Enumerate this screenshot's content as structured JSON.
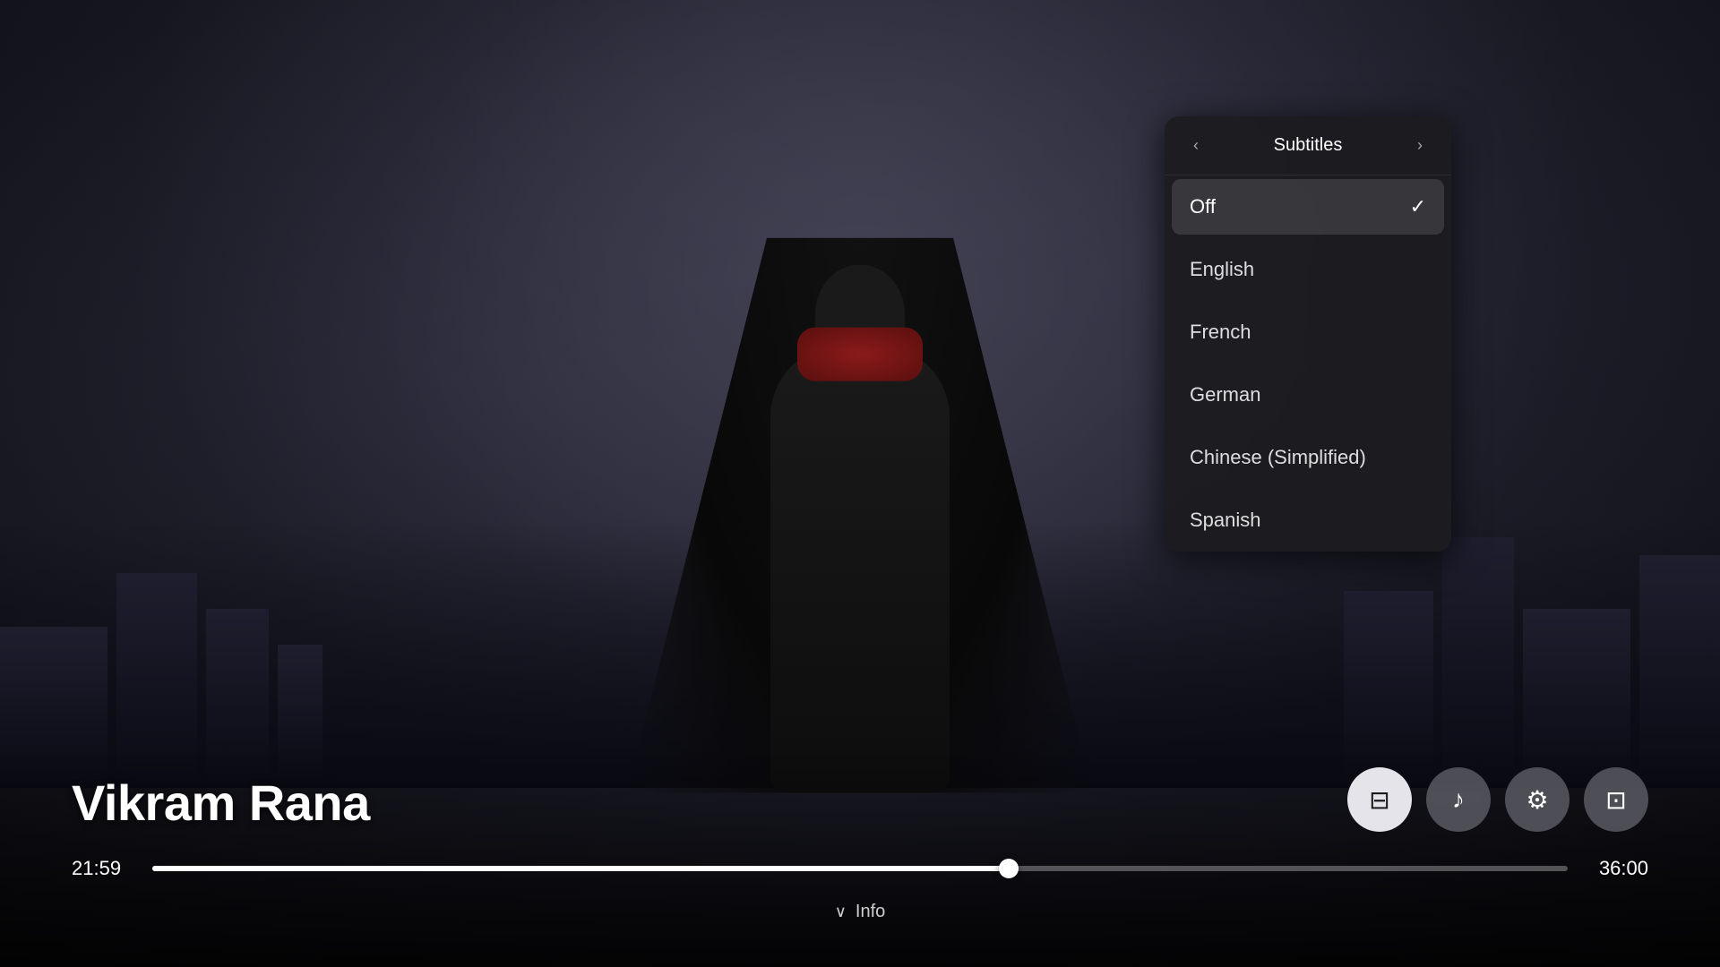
{
  "movie": {
    "title": "Vikram Rana",
    "current_time": "21:59",
    "end_time": "36:00",
    "progress_percent": 60.5
  },
  "subtitles_panel": {
    "title": "Subtitles",
    "nav_prev": "‹",
    "nav_next": "›",
    "options": [
      {
        "id": "off",
        "label": "Off",
        "selected": true
      },
      {
        "id": "english",
        "label": "English",
        "selected": false
      },
      {
        "id": "french",
        "label": "French",
        "selected": false
      },
      {
        "id": "german",
        "label": "German",
        "selected": false
      },
      {
        "id": "chinese-simplified",
        "label": "Chinese (Simplified)",
        "selected": false
      },
      {
        "id": "spanish",
        "label": "Spanish",
        "selected": false
      }
    ]
  },
  "controls": {
    "subtitles_icon": "⊟",
    "audio_icon": "♪",
    "settings_icon": "⚙",
    "pip_icon": "⊡",
    "info_label": "Info"
  },
  "colors": {
    "panel_bg": "#1c1c20",
    "selected_bg": "#3a3a3e",
    "text_primary": "#ffffff",
    "text_secondary": "rgba(255,255,255,0.85)"
  }
}
